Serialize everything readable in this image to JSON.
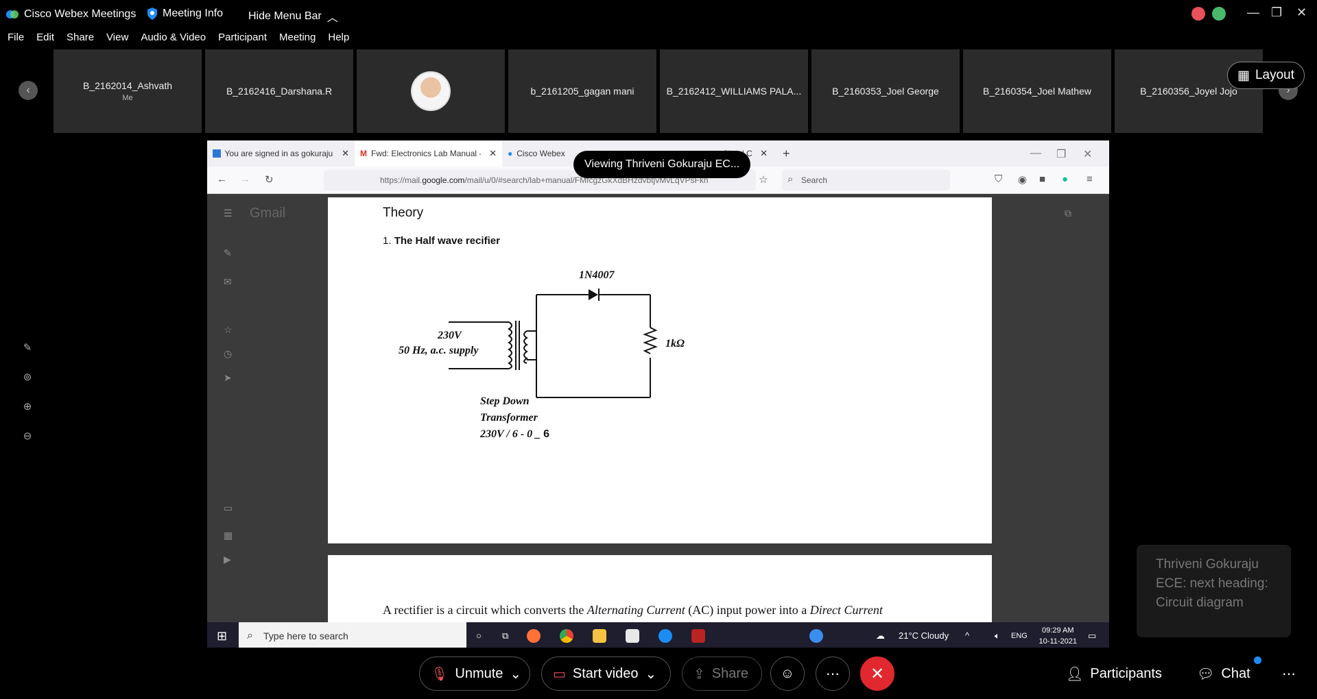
{
  "titlebar": {
    "app_name": "Cisco Webex Meetings",
    "meeting_info": "Meeting Info",
    "hide_menu": "Hide Menu Bar"
  },
  "menu": [
    "File",
    "Edit",
    "Share",
    "View",
    "Audio & Video",
    "Participant",
    "Meeting",
    "Help"
  ],
  "participants": [
    {
      "name": "B_2162014_Ashvath",
      "sub": "Me"
    },
    {
      "name": "B_2162416_Darshana.R",
      "sub": ""
    },
    {
      "name": "",
      "sub": ""
    },
    {
      "name": "b_2161205_gagan mani",
      "sub": ""
    },
    {
      "name": "B_2162412_WILLIAMS PALA...",
      "sub": ""
    },
    {
      "name": "B_2160353_Joel George",
      "sub": ""
    },
    {
      "name": "B_2160354_Joel Mathew",
      "sub": ""
    },
    {
      "name": "B_2160356_Joyel Jojo",
      "sub": ""
    }
  ],
  "layout_label": "Layout",
  "browser": {
    "tabs": [
      {
        "title": "You are signed in as gokuraju.th"
      },
      {
        "title": "Fwd: Electronics Lab Manual - g"
      },
      {
        "title": "Cisco Webex M"
      },
      {
        "title": "g, Cloud Call"
      }
    ],
    "viewing": "Viewing Thriveni Gokuraju EC...",
    "url_prefix": "https://mail.",
    "url_domain": "google.com",
    "url_rest": "/mail/u/0/#search/lab+manual/FMfcgzGkXdBHzdvbtjvMvLqVPsFkn",
    "search_placeholder": "Search",
    "gmail_label": "Gmail"
  },
  "document": {
    "theory": "Theory",
    "section_num": "1.",
    "section_title": "The Half wave recifier",
    "circuit": {
      "diode": "1N4007",
      "voltage": "230V",
      "supply": "50 Hz, a.c. supply",
      "resistor": "1kΩ",
      "xfmr_line1": "Step Down",
      "xfmr_line2": "Transformer",
      "xfmr_line3": "230V / 6  - 0 _",
      "xfmr_ratio_end": "6"
    },
    "page2_text_a": "A rectifier is a circuit which converts the ",
    "page2_em1": "Alternating Current",
    "page2_text_b": " (AC) input power into a ",
    "page2_em2": "Direct Current"
  },
  "taskbar": {
    "search": "Type here to search",
    "weather": "21°C  Cloudy",
    "lang": "ENG",
    "time": "09:29 AM",
    "date": "10-11-2021"
  },
  "toast": "Thriveni Gokuraju ECE: next heading: Circuit diagram",
  "controls": {
    "unmute": "Unmute",
    "start_video": "Start video",
    "share": "Share",
    "participants": "Participants",
    "chat": "Chat"
  },
  "colors": {
    "end_call": "#e0282e",
    "chat_badge": "#1d8df6"
  }
}
